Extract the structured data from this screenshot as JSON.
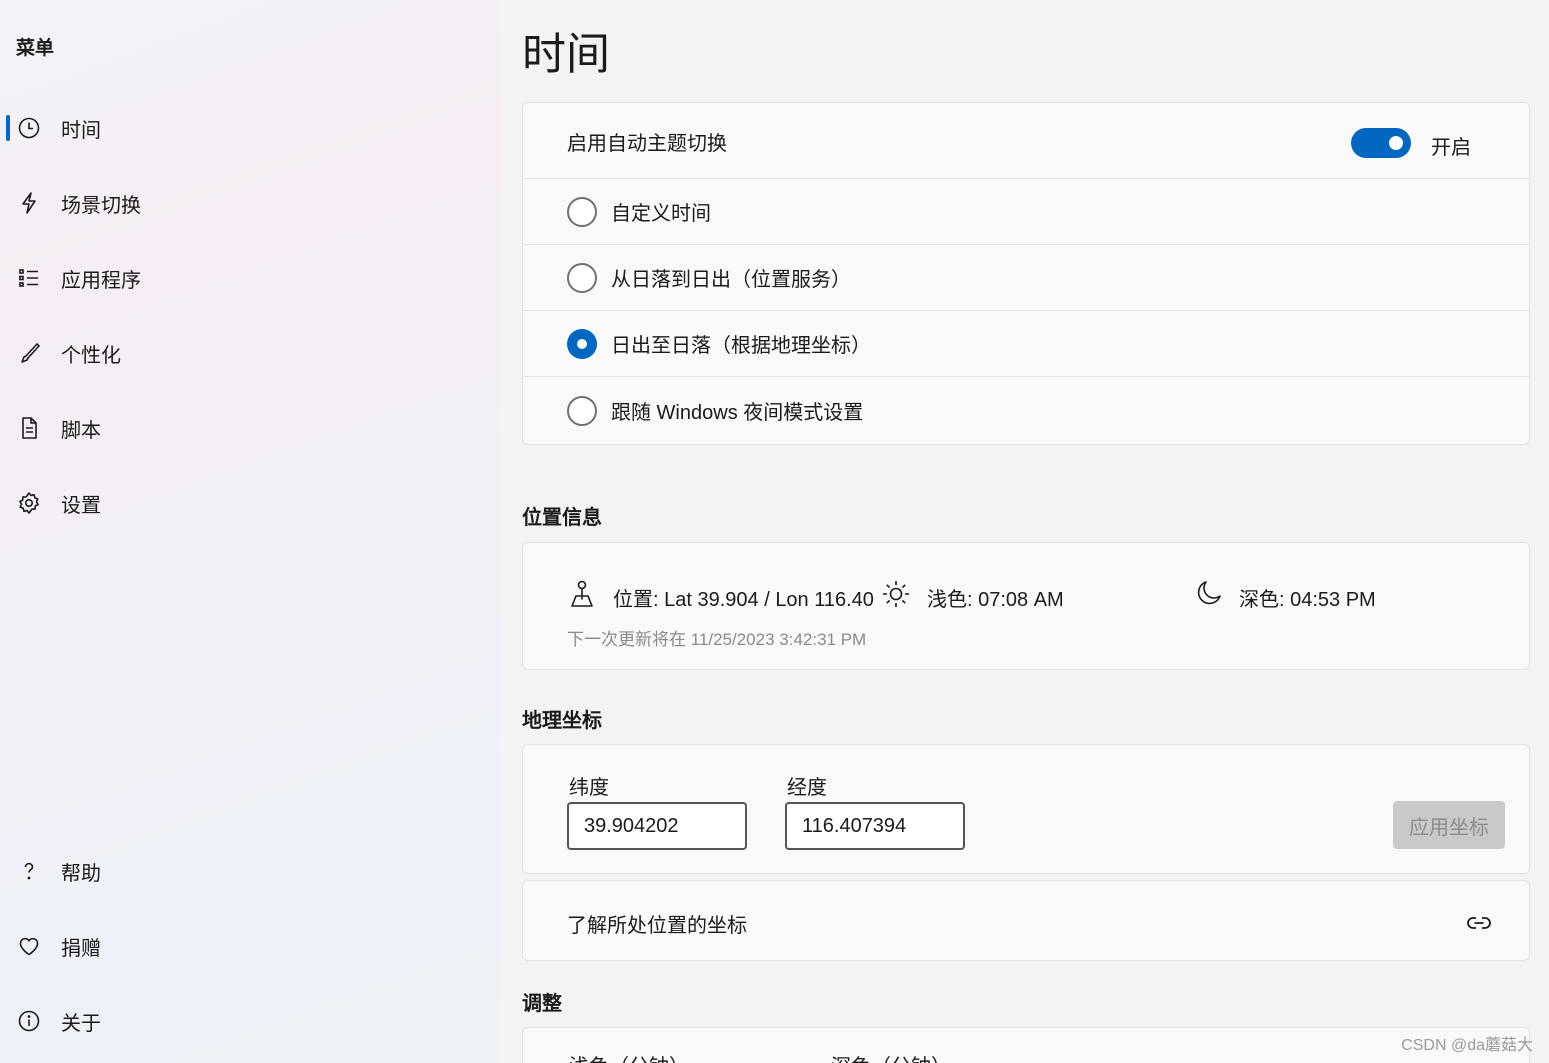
{
  "sidebar": {
    "title": "菜单",
    "items": [
      {
        "label": "时间",
        "icon": "clock-icon",
        "active": true
      },
      {
        "label": "场景切换",
        "icon": "lightning-icon"
      },
      {
        "label": "应用程序",
        "icon": "list-icon"
      },
      {
        "label": "个性化",
        "icon": "brush-icon"
      },
      {
        "label": "脚本",
        "icon": "document-icon"
      },
      {
        "label": "设置",
        "icon": "gear-icon"
      }
    ],
    "footer_items": [
      {
        "label": "帮助",
        "icon": "help-icon"
      },
      {
        "label": "捐赠",
        "icon": "heart-icon"
      },
      {
        "label": "关于",
        "icon": "info-icon"
      }
    ]
  },
  "page": {
    "title": "时间"
  },
  "theme_card": {
    "toggle_label": "启用自动主题切换",
    "toggle_state": "开启",
    "toggle_on": true,
    "options": [
      {
        "label": "自定义时间",
        "checked": false
      },
      {
        "label": "从日落到日出（位置服务）",
        "checked": false
      },
      {
        "label": "日出至日落（根据地理坐标）",
        "checked": true
      },
      {
        "label": "跟随 Windows 夜间模式设置",
        "checked": false
      }
    ]
  },
  "location": {
    "heading": "位置信息",
    "position": "位置: Lat 39.904 / Lon 116.40",
    "light": "浅色: 07:08 AM",
    "dark": "深色: 04:53 PM",
    "next_update": "下一次更新将在 11/25/2023 3:42:31 PM"
  },
  "geo": {
    "heading": "地理坐标",
    "lat_label": "纬度",
    "lat_value": "39.904202",
    "lon_label": "经度",
    "lon_value": "116.407394",
    "apply_label": "应用坐标",
    "link_text": "了解所处位置的坐标"
  },
  "adjust": {
    "heading": "调整",
    "light_label": "浅色（分钟）",
    "dark_label": "深色（分钟）"
  },
  "watermark": "CSDN @da蘑菇大",
  "colors": {
    "accent": "#0067c0"
  }
}
